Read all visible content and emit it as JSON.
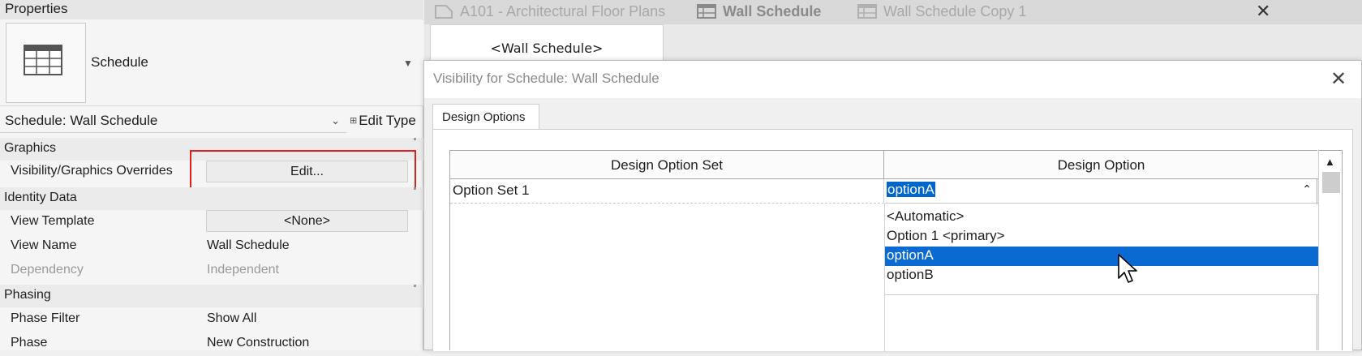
{
  "properties": {
    "title": "Properties",
    "type_name": "Schedule",
    "schedule_selector": "Schedule: Wall Schedule",
    "edit_type": "Edit Type",
    "groups": {
      "graphics": "Graphics",
      "identity": "Identity Data",
      "phasing": "Phasing"
    },
    "rows": {
      "vg_overrides": {
        "label": "Visibility/Graphics Overrides",
        "value": "Edit..."
      },
      "view_template": {
        "label": "View Template",
        "value": "<None>"
      },
      "view_name": {
        "label": "View Name",
        "value": "Wall Schedule"
      },
      "dependency": {
        "label": "Dependency",
        "value": "Independent"
      },
      "phase_filter": {
        "label": "Phase Filter",
        "value": "Show All"
      },
      "phase": {
        "label": "Phase",
        "value": "New Construction"
      }
    }
  },
  "tabs": [
    {
      "label": "A101 - Architectural Floor Plans",
      "icon": "floor-plan-icon"
    },
    {
      "label": "Wall Schedule",
      "icon": "schedule-icon",
      "active": true
    },
    {
      "label": "Wall Schedule Copy 1",
      "icon": "schedule-icon"
    }
  ],
  "view": {
    "header": "<Wall Schedule>"
  },
  "dialog": {
    "title": "Visibility for Schedule: Wall Schedule",
    "tab": "Design Options",
    "columns": [
      "Design Option Set",
      "Design Option"
    ],
    "row": {
      "set": "Option Set 1",
      "option": "optionA"
    },
    "dropdown_options": [
      "<Automatic>",
      "Option 1  <primary>",
      "optionA",
      "optionB"
    ],
    "selected_option": "optionA"
  },
  "colors": {
    "highlight": "#e02020",
    "selection": "#0a6ad1"
  }
}
